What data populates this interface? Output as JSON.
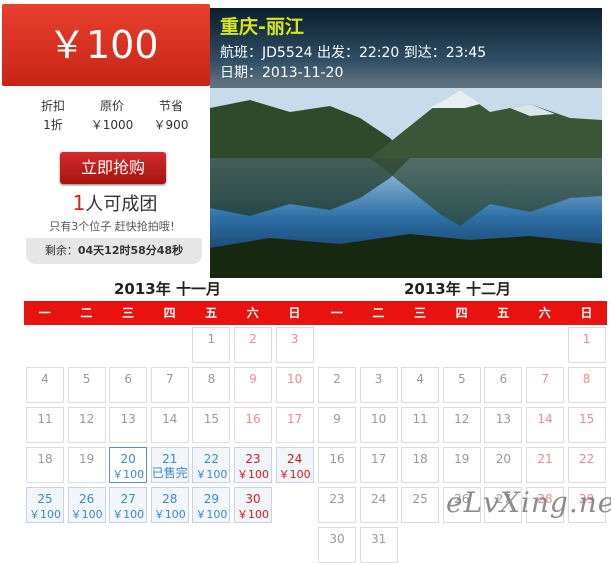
{
  "price": {
    "label": "￥100"
  },
  "route": {
    "title": "重庆-丽江",
    "flight_line": "航班：JD5524 出发：22:20 到达：23:45",
    "date_line": "日期：2013-11-20"
  },
  "stats": [
    {
      "label": "折扣",
      "value": "1折"
    },
    {
      "label": "原价",
      "value": "￥1000"
    },
    {
      "label": "节省",
      "value": "￥900"
    }
  ],
  "buy_button": "立即抢购",
  "group": {
    "count": "1",
    "suffix": "人可成团"
  },
  "hint": "只有3个位子   赶快抢拍哦！",
  "remain": {
    "label": "剩余：",
    "value": "04天12时58分48秒"
  },
  "calendars": {
    "november_title": "2013年 十一月",
    "december_title": "2013年 十二月",
    "weekdays": [
      "一",
      "二",
      "三",
      "四",
      "五",
      "六",
      "日"
    ],
    "november": [
      {
        "d": "1"
      },
      {
        "d": "2",
        "we": true
      },
      {
        "d": "3",
        "we": true
      },
      {
        "d": "4"
      },
      {
        "d": "5"
      },
      {
        "d": "6"
      },
      {
        "d": "7"
      },
      {
        "d": "8"
      },
      {
        "d": "9",
        "we": true
      },
      {
        "d": "10",
        "we": true
      },
      {
        "d": "11"
      },
      {
        "d": "12"
      },
      {
        "d": "13"
      },
      {
        "d": "14"
      },
      {
        "d": "15"
      },
      {
        "d": "16",
        "we": true
      },
      {
        "d": "17",
        "we": true
      },
      {
        "d": "18"
      },
      {
        "d": "19"
      },
      {
        "d": "20",
        "p": "￥100",
        "act": true,
        "sel": true
      },
      {
        "d": "21",
        "p": "已售完",
        "act": true,
        "sold": true
      },
      {
        "d": "22",
        "p": "￥100",
        "act": true
      },
      {
        "d": "23",
        "p": "￥100",
        "act": true,
        "we": true
      },
      {
        "d": "24",
        "p": "￥100",
        "act": true,
        "we": true
      },
      {
        "d": "25",
        "p": "￥100",
        "act": true
      },
      {
        "d": "26",
        "p": "￥100",
        "act": true
      },
      {
        "d": "27",
        "p": "￥100",
        "act": true
      },
      {
        "d": "28",
        "p": "￥100",
        "act": true
      },
      {
        "d": "29",
        "p": "￥100",
        "act": true
      },
      {
        "d": "30",
        "p": "￥100",
        "act": true,
        "we": true
      }
    ],
    "december": [
      {
        "d": "1",
        "we": true
      },
      {
        "d": "2"
      },
      {
        "d": "3"
      },
      {
        "d": "4"
      },
      {
        "d": "5"
      },
      {
        "d": "6"
      },
      {
        "d": "7",
        "we": true
      },
      {
        "d": "8",
        "we": true
      },
      {
        "d": "9"
      },
      {
        "d": "10"
      },
      {
        "d": "11"
      },
      {
        "d": "12"
      },
      {
        "d": "13"
      },
      {
        "d": "14",
        "we": true
      },
      {
        "d": "15",
        "we": true
      },
      {
        "d": "16"
      },
      {
        "d": "17"
      },
      {
        "d": "18"
      },
      {
        "d": "19"
      },
      {
        "d": "20"
      },
      {
        "d": "21",
        "we": true
      },
      {
        "d": "22",
        "we": true
      },
      {
        "d": "23"
      },
      {
        "d": "24"
      },
      {
        "d": "25"
      },
      {
        "d": "26"
      },
      {
        "d": "27"
      },
      {
        "d": "28",
        "we": true
      },
      {
        "d": "29",
        "we": true
      },
      {
        "d": "30"
      },
      {
        "d": "31"
      }
    ]
  },
  "watermark": "eLvXing.net",
  "colors": {
    "accent_red": "#e8120f",
    "price_blue": "#3b89c9",
    "title_yellow": "#d8e61e"
  }
}
